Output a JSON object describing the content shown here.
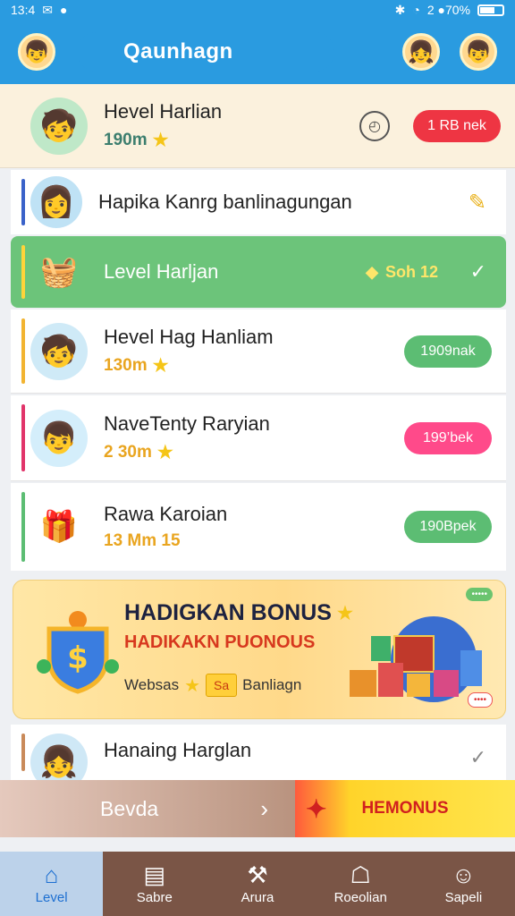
{
  "status_bar": {
    "time": "13:4",
    "signal": "2 ●70%"
  },
  "search": {
    "text": "Qaunhagn"
  },
  "rows": [
    {
      "title": "Hevel Harlian",
      "sub": "190m",
      "pill": "1 RB nek",
      "pill_color": "#ee3543"
    },
    {
      "title": "Hapika Kanrg banlinagungan",
      "sub": ""
    },
    {
      "title": "Level Harljan",
      "note": "Soh  12"
    },
    {
      "title": "Hevel Hag Hanliam",
      "sub": "130m",
      "pill": "1909nak",
      "pill_color": "#5cbd73"
    },
    {
      "title": "NaveTenty Raryian",
      "sub": "2 30m",
      "pill": "199’bek",
      "pill_color": "#ff4a8a"
    },
    {
      "title": "Rawa Karoian",
      "sub": "13 Mm  15",
      "pill": "190Bpek",
      "pill_color": "#5cbd73"
    },
    {
      "title": "Hanaing Harglan"
    }
  ],
  "banner": {
    "title": "HADIGKAN BONUS",
    "subtitle": "HADIKAKN PUONOUS",
    "foot_left": "Websas",
    "tag": "Sa",
    "foot_right": "Banliagn",
    "corner_top": "•••••",
    "corner_bottom": "••••"
  },
  "action_bar": {
    "left": "Bevda",
    "right": "HEMONUS"
  },
  "nav": [
    {
      "label": "Level",
      "icon": "⌂"
    },
    {
      "label": "Sabre",
      "icon": "▤"
    },
    {
      "label": "Arura",
      "icon": "⚒"
    },
    {
      "label": "Roeolian",
      "icon": "☖"
    },
    {
      "label": "Sapeli",
      "icon": "☺"
    }
  ],
  "colors": {
    "accent": "#2a9be0",
    "nav": "#7a5546",
    "green": "#6cc47a"
  },
  "icons": {
    "thumbs": [
      "boy-avatar",
      "girl-avatar",
      "basket",
      "boy-avatar",
      "kid-avatar",
      "gift-basket",
      "girl-avatar"
    ]
  }
}
